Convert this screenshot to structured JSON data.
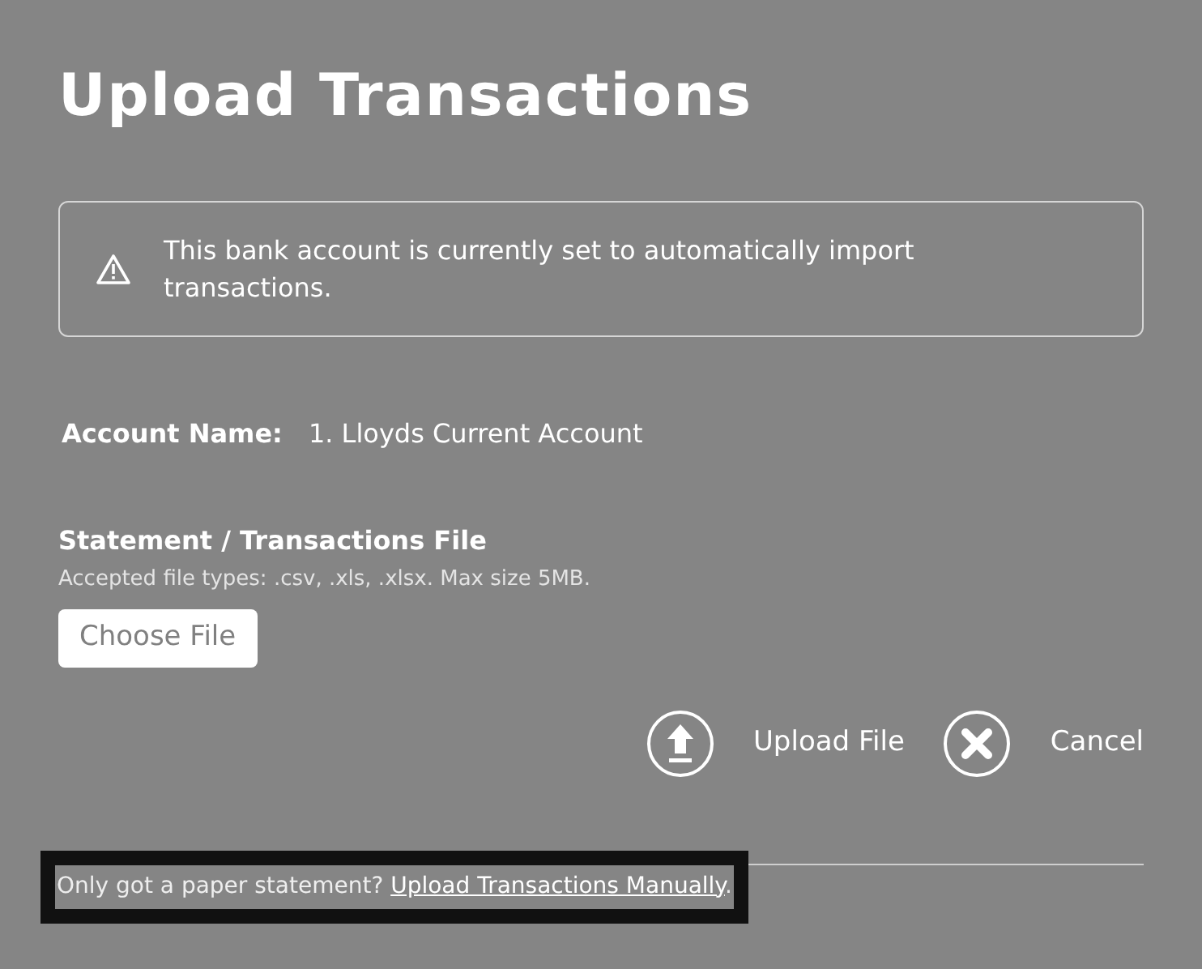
{
  "title": "Upload Transactions",
  "alert": {
    "text": "This bank account is currently set to automatically import transactions."
  },
  "account": {
    "label": "Account Name:",
    "value": "1. Lloyds Current Account"
  },
  "file_section": {
    "heading": "Statement / Transactions File",
    "hint": "Accepted file types: .csv, .xls, .xlsx. Max size 5MB.",
    "button": "Choose File"
  },
  "actions": [
    {
      "kind": "upload",
      "label": "Upload File"
    },
    {
      "kind": "cancel",
      "label": "Cancel"
    }
  ],
  "footer": {
    "prompt": "Only got a paper statement?",
    "link": "Upload Transactions Manually",
    "suffix": ".",
    "focused": true
  }
}
